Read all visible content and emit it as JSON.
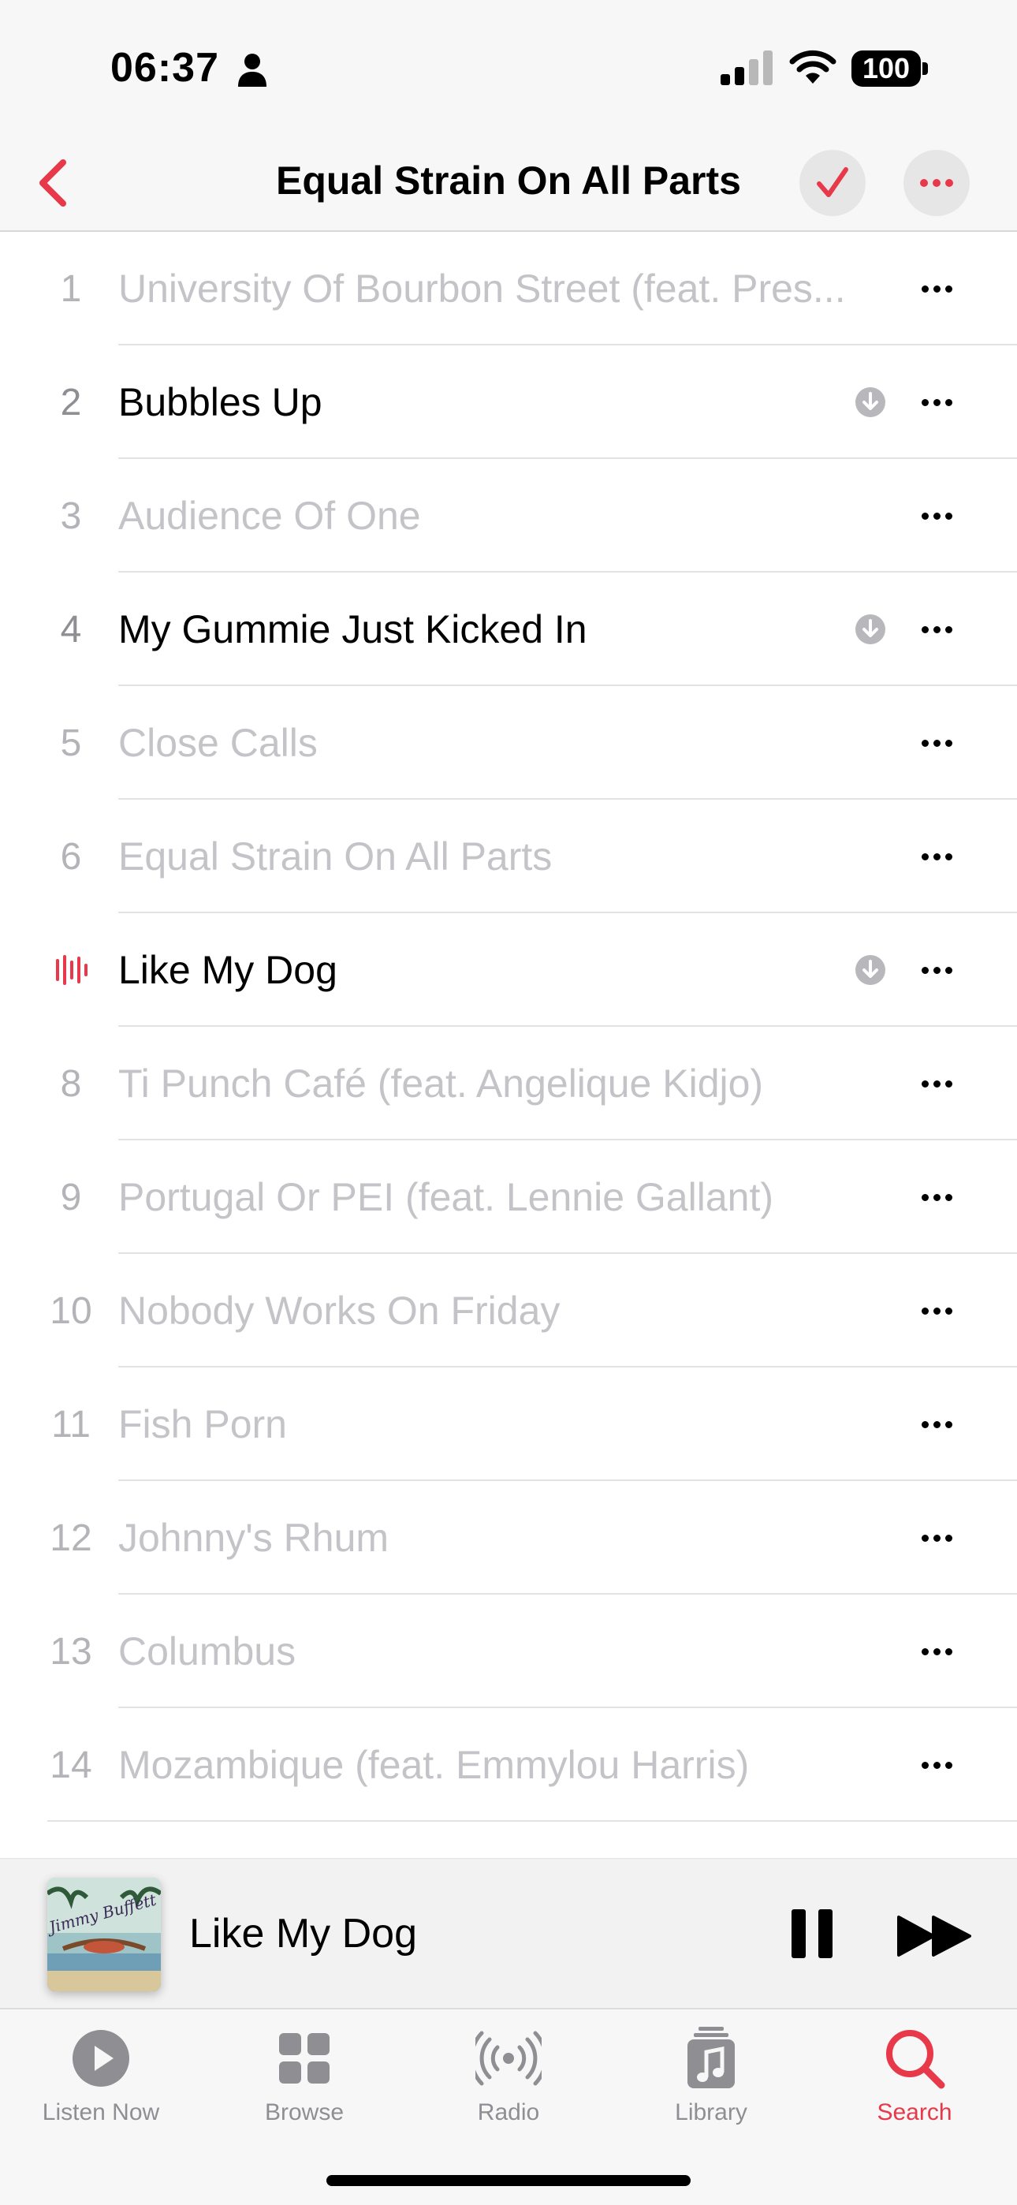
{
  "status_bar": {
    "time": "06:37",
    "battery": "100",
    "icons": [
      "person-icon",
      "signal-icon",
      "wifi-icon",
      "battery-icon"
    ]
  },
  "nav": {
    "title": "Equal Strain On All Parts",
    "back_icon": "chevron-left-icon",
    "done_icon": "checkmark-icon",
    "more_icon": "ellipsis-icon",
    "accent_color": "#e8394a"
  },
  "tracks": [
    {
      "number": "1",
      "title": "University Of Bourbon Street (feat. Pres...",
      "available": false,
      "downloaded": false
    },
    {
      "number": "2",
      "title": "Bubbles Up",
      "available": true,
      "downloaded": true
    },
    {
      "number": "3",
      "title": "Audience Of One",
      "available": false,
      "downloaded": false
    },
    {
      "number": "4",
      "title": "My Gummie Just Kicked In",
      "available": true,
      "downloaded": true
    },
    {
      "number": "5",
      "title": "Close Calls",
      "available": false,
      "downloaded": false
    },
    {
      "number": "6",
      "title": "Equal Strain On All Parts",
      "available": false,
      "downloaded": false
    },
    {
      "number": "",
      "title": "Like My Dog",
      "available": true,
      "downloaded": true,
      "playing": true
    },
    {
      "number": "8",
      "title": "Ti Punch Café (feat. Angelique Kidjo)",
      "available": false,
      "downloaded": false
    },
    {
      "number": "9",
      "title": "Portugal Or PEI (feat. Lennie Gallant)",
      "available": false,
      "downloaded": false
    },
    {
      "number": "10",
      "title": "Nobody Works On Friday",
      "available": false,
      "downloaded": false
    },
    {
      "number": "11",
      "title": "Fish Porn",
      "available": false,
      "downloaded": false
    },
    {
      "number": "12",
      "title": "Johnny's Rhum",
      "available": false,
      "downloaded": false
    },
    {
      "number": "13",
      "title": "Columbus",
      "available": false,
      "downloaded": false
    },
    {
      "number": "14",
      "title": "Mozambique (feat. Emmylou Harris)",
      "available": false,
      "downloaded": false
    }
  ],
  "mini_player": {
    "title": "Like My Dog",
    "artwork_text": "Jimmy Buffett",
    "pause_icon": "pause-icon",
    "forward_icon": "forward-icon"
  },
  "tabs": [
    {
      "label": "Listen Now",
      "icon": "play-circle-icon",
      "active": false
    },
    {
      "label": "Browse",
      "icon": "grid-icon",
      "active": false
    },
    {
      "label": "Radio",
      "icon": "radio-icon",
      "active": false
    },
    {
      "label": "Library",
      "icon": "music-library-icon",
      "active": false
    },
    {
      "label": "Search",
      "icon": "search-icon",
      "active": true
    }
  ]
}
